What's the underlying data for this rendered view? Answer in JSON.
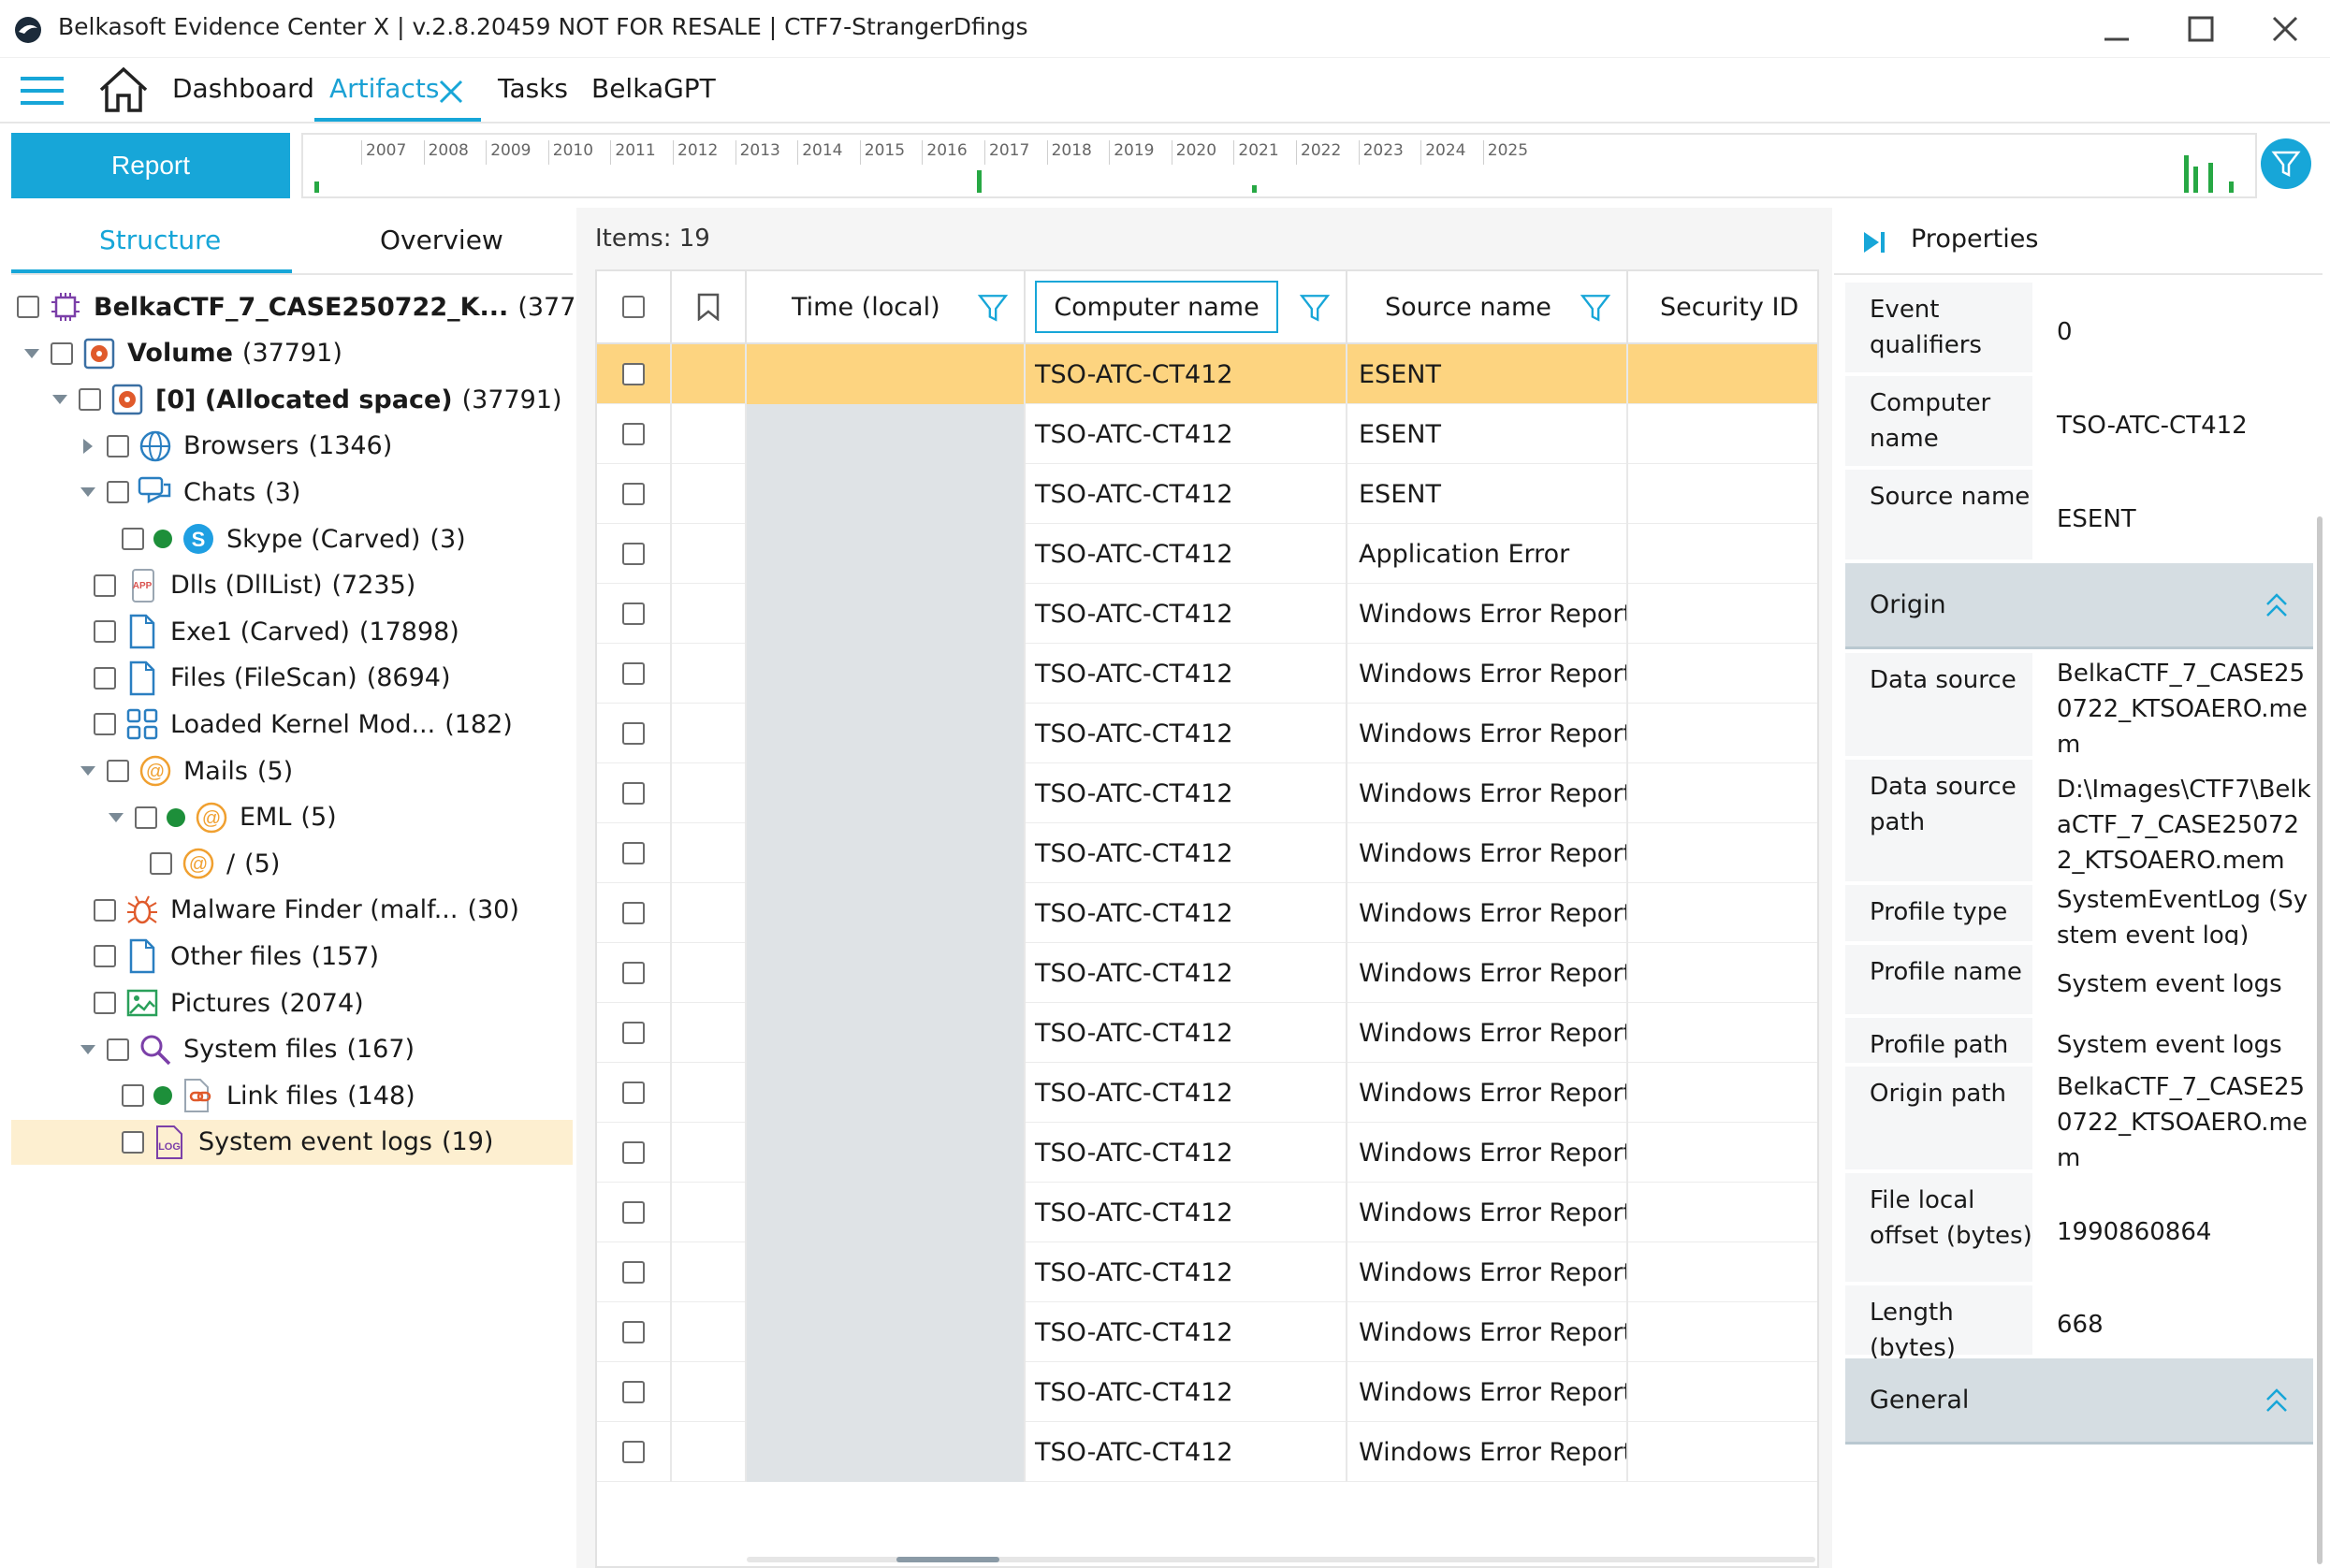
{
  "window": {
    "title": "Belkasoft Evidence Center X | v.2.8.20459 NOT FOR RESALE | CTF7-StrangerDfings"
  },
  "menu": {
    "dashboard": "Dashboard",
    "artifacts": "Artifacts",
    "tasks": "Tasks",
    "belkagpt": "BelkaGPT"
  },
  "toolbar": {
    "report": "Report"
  },
  "timeline": {
    "years": [
      "2007",
      "2008",
      "2009",
      "2010",
      "2011",
      "2012",
      "2013",
      "2014",
      "2015",
      "2016",
      "2017",
      "2018",
      "2019",
      "2020",
      "2021",
      "2022",
      "2023",
      "2024",
      "2025"
    ]
  },
  "left": {
    "tab_structure": "Structure",
    "tab_overview": "Overview",
    "tree": [
      {
        "label": "BelkaCTF_7_CASE250722_K...",
        "count": "(37791)",
        "bold": true
      },
      {
        "label": "Volume",
        "count": "(37791)",
        "bold": true
      },
      {
        "label": "[0] (Allocated space)",
        "count": "(37791)",
        "bold": true
      },
      {
        "label": "Browsers",
        "count": "(1346)"
      },
      {
        "label": "Chats",
        "count": "(3)"
      },
      {
        "label": "Skype (Carved)",
        "count": "(3)"
      },
      {
        "label": "Dlls (DllList)",
        "count": "(7235)"
      },
      {
        "label": "Exe1 (Carved)",
        "count": "(17898)"
      },
      {
        "label": "Files (FileScan)",
        "count": "(8694)"
      },
      {
        "label": "Loaded Kernel Mod...",
        "count": "(182)"
      },
      {
        "label": "Mails",
        "count": "(5)"
      },
      {
        "label": "EML",
        "count": "(5)"
      },
      {
        "label": "/",
        "count": "(5)"
      },
      {
        "label": "Malware Finder (malf...",
        "count": "(30)"
      },
      {
        "label": "Other files",
        "count": "(157)"
      },
      {
        "label": "Pictures",
        "count": "(2074)"
      },
      {
        "label": "System files",
        "count": "(167)"
      },
      {
        "label": "Link files",
        "count": "(148)"
      },
      {
        "label": "System event logs",
        "count": "(19)"
      }
    ]
  },
  "grid": {
    "items_label": "Items: 19",
    "columns": {
      "time": "Time (local)",
      "computer": "Computer name",
      "source": "Source name",
      "security": "Security ID"
    },
    "rows": [
      {
        "computer": "TSO-ATC-CT412",
        "source": "ESENT"
      },
      {
        "computer": "TSO-ATC-CT412",
        "source": "ESENT"
      },
      {
        "computer": "TSO-ATC-CT412",
        "source": "ESENT"
      },
      {
        "computer": "TSO-ATC-CT412",
        "source": "Application Error"
      },
      {
        "computer": "TSO-ATC-CT412",
        "source": "Windows Error Report"
      },
      {
        "computer": "TSO-ATC-CT412",
        "source": "Windows Error Report"
      },
      {
        "computer": "TSO-ATC-CT412",
        "source": "Windows Error Report"
      },
      {
        "computer": "TSO-ATC-CT412",
        "source": "Windows Error Report"
      },
      {
        "computer": "TSO-ATC-CT412",
        "source": "Windows Error Report"
      },
      {
        "computer": "TSO-ATC-CT412",
        "source": "Windows Error Report"
      },
      {
        "computer": "TSO-ATC-CT412",
        "source": "Windows Error Report"
      },
      {
        "computer": "TSO-ATC-CT412",
        "source": "Windows Error Report"
      },
      {
        "computer": "TSO-ATC-CT412",
        "source": "Windows Error Report"
      },
      {
        "computer": "TSO-ATC-CT412",
        "source": "Windows Error Report"
      },
      {
        "computer": "TSO-ATC-CT412",
        "source": "Windows Error Report"
      },
      {
        "computer": "TSO-ATC-CT412",
        "source": "Windows Error Report"
      },
      {
        "computer": "TSO-ATC-CT412",
        "source": "Windows Error Report"
      },
      {
        "computer": "TSO-ATC-CT412",
        "source": "Windows Error Report"
      },
      {
        "computer": "TSO-ATC-CT412",
        "source": "Windows Error Report"
      }
    ]
  },
  "properties": {
    "title": "Properties",
    "top": [
      {
        "key": "Event qualifiers",
        "value": "0"
      },
      {
        "key": "Computer name",
        "value": "TSO-ATC-CT412"
      },
      {
        "key": "Source name",
        "value": "ESENT"
      }
    ],
    "origin_section": "Origin",
    "origin": [
      {
        "key": "Data source",
        "value": "BelkaCTF_7_CASE250722_KTSOAERO.mem"
      },
      {
        "key": "Data source path",
        "value": "D:\\Images\\CTF7\\BelkaCTF_7_CASE250722_KTSOAERO.mem"
      },
      {
        "key": "Profile type",
        "value": "SystemEventLog (System event log)"
      },
      {
        "key": "Profile name",
        "value": "System event logs"
      },
      {
        "key": "Profile path",
        "value": "System event logs"
      },
      {
        "key": "Origin path",
        "value": "BelkaCTF_7_CASE250722_KTSOAERO.mem"
      },
      {
        "key": "File local offset (bytes)",
        "value": "1990860864"
      },
      {
        "key": "Length (bytes)",
        "value": "668"
      }
    ],
    "general_section": "General"
  },
  "colors": {
    "accent": "#17a6d8",
    "selected_row": "#fdd480",
    "tree_selected": "#fdefd0",
    "status_green": "#1d8f3a"
  }
}
